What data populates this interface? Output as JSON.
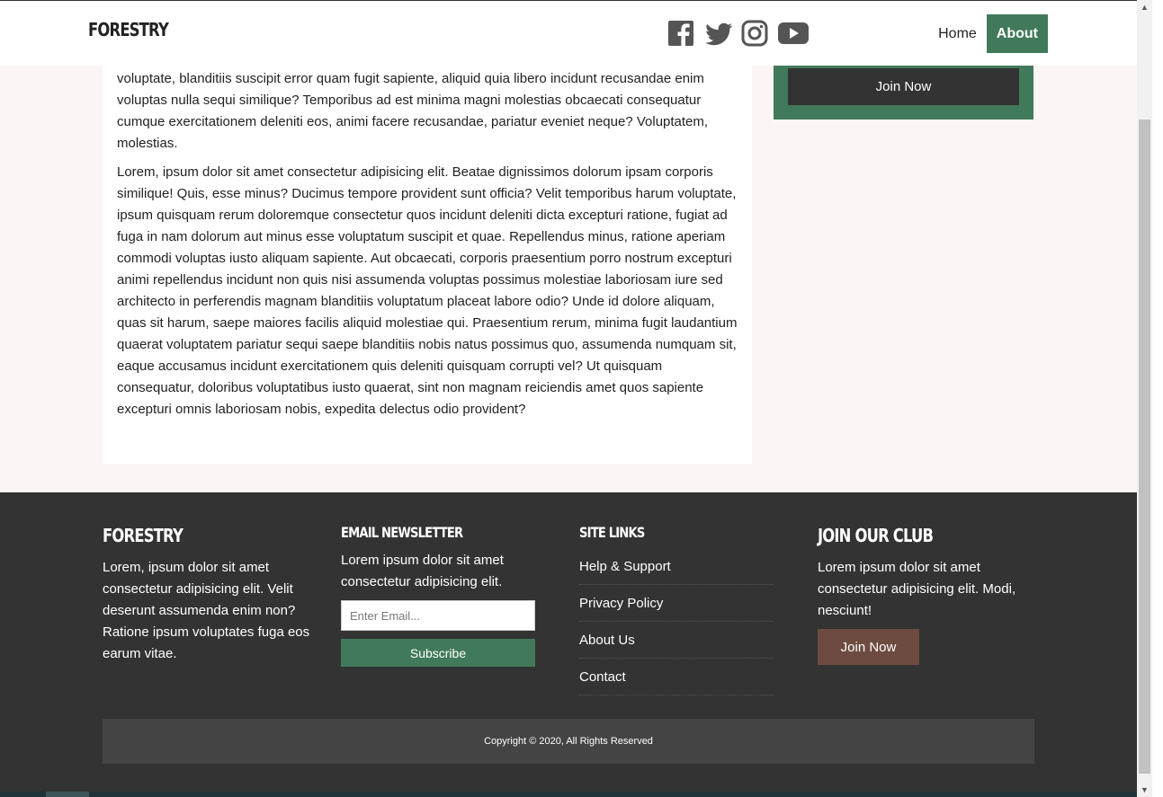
{
  "header": {
    "logo": "FORESTRY",
    "social_icons": [
      "facebook-icon",
      "twitter-icon",
      "instagram-icon",
      "youtube-icon"
    ],
    "nav": [
      {
        "label": "Home",
        "active": false
      },
      {
        "label": "About",
        "active": true
      }
    ]
  },
  "main": {
    "paragraph_1": "voluptate, blanditiis suscipit error quam fugit sapiente, aliquid quia libero incidunt recusandae enim voluptas nulla sequi similique? Temporibus ad est minima magni molestias obcaecati consequatur cumque exercitationem deleniti eos, animi facere recusandae, pariatur eveniet neque? Voluptatem, molestias.",
    "paragraph_2": "Lorem, ipsum dolor sit amet consectetur adipisicing elit. Beatae dignissimos dolorum ipsam corporis similique! Quis, esse minus? Ducimus tempore provident sunt officia? Velit temporibus harum voluptate, ipsum quisquam rerum doloremque consectetur quos incidunt deleniti dicta excepturi ratione, fugiat ad fuga in nam dolorum aut minus esse voluptatum suscipit et quae. Repellendus minus, ratione aperiam commodi voluptas iusto aliquam sapiente. Aut obcaecati, corporis praesentium porro nostrum excepturi animi repellendus incidunt non quis nisi assumenda voluptas possimus molestiae laboriosam iure sed architecto in perferendis magnam blanditiis voluptatum placeat labore odio? Unde id dolore aliquam, quas sit harum, saepe maiores facilis aliquid molestiae qui. Praesentium rerum, minima fugit laudantium quaerat voluptatem pariatur sequi saepe blanditiis nobis natus possimus quo, assumenda numquam sit, eaque accusamus incidunt exercitationem quis deleniti quisquam corrupti vel? Ut quisquam consequatur, doloribus voluptatibus iusto quaerat, sint non magnam reiciendis amet quos sapiente excepturi omnis laboriosam nobis, expedita delectus odio provident?"
  },
  "sidebar": {
    "join_label": "Join Now"
  },
  "footer": {
    "about": {
      "title": "FORESTRY",
      "text": "Lorem, ipsum dolor sit amet consectetur adipisicing elit. Velit deserunt assumenda enim non? Ratione ipsum voluptates fuga eos earum vitae."
    },
    "newsletter": {
      "title": "EMAIL NEWSLETTER",
      "text": "Lorem ipsum dolor sit amet consectetur adipisicing elit.",
      "placeholder": "Enter Email...",
      "button": "Subscribe"
    },
    "site_links": {
      "title": "SITE LINKS",
      "items": [
        "Help & Support",
        "Privacy Policy",
        "About Us",
        "Contact"
      ]
    },
    "club": {
      "title": "JOIN OUR CLUB",
      "text": "Lorem ipsum dolor sit amet consectetur adipisicing elit. Modi, nesciunt!",
      "button": "Join Now"
    },
    "copyright": "Copyright © 2020, All Rights Reserved"
  },
  "colors": {
    "accent_green": "#417a5a",
    "dark": "#333333",
    "brown": "#6e4b41"
  }
}
